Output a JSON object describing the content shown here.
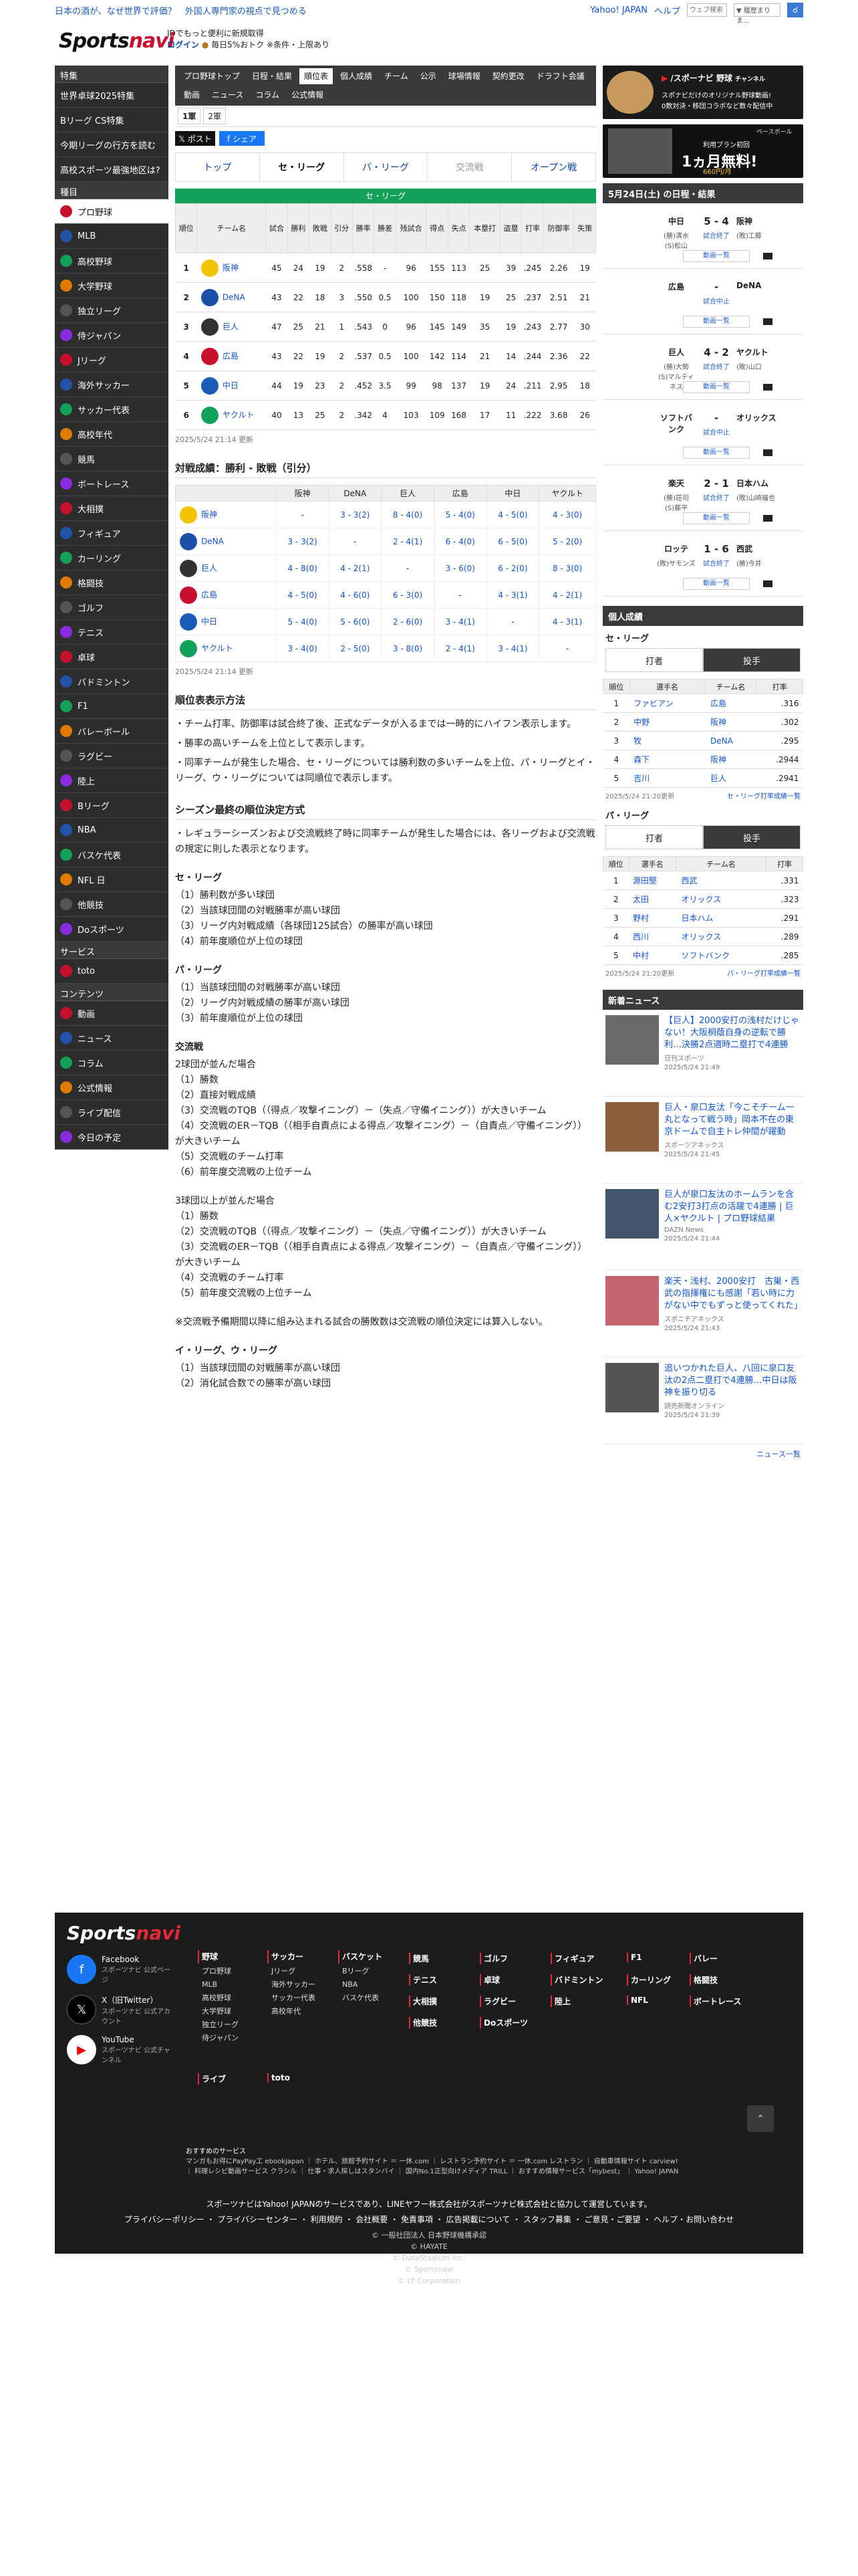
{
  "topbar": {
    "pr": "日本の酒が、なぜ世界で評価？　外国人専門家の視点で見つめる",
    "yahoo": "Yahoo! JAPAN",
    "help": "ヘルプ",
    "search_placeholder": "ウェブ検索",
    "search_scope": "▼ 履歴まり ま..."
  },
  "header": {
    "logo_a": "Sports",
    "logo_b": "navi",
    "id_line": "IDでもっと便利に新規取得",
    "login": "ログイン",
    "points": "毎日5%おトク ※条件・上限あり"
  },
  "sidebar": {
    "sec1": "特集",
    "sec1_items": [
      "世界卓球2025特集",
      "Bリーグ CS特集",
      "今期リーグの行方を読む",
      "高校スポーツ最強地区は?"
    ],
    "sec2": "種目",
    "sec2_items": [
      "プロ野球",
      "MLB",
      "高校野球",
      "大学野球",
      "独立リーグ",
      "侍ジャパン",
      "Jリーグ",
      "海外サッカー",
      "サッカー代表",
      "高校年代",
      "競馬",
      "ボートレース",
      "大相撲",
      "フィギュア",
      "カーリング",
      "格闘技",
      "ゴルフ",
      "テニス",
      "卓球",
      "バドミントン",
      "F1",
      "バレーボール",
      "ラグビー",
      "陸上",
      "Bリーグ",
      "NBA",
      "バスケ代表",
      "NFL 日",
      "他競技",
      "Doスポーツ"
    ],
    "sec3": "サービス",
    "sec3_items": [
      "toto"
    ],
    "sec4": "コンテンツ",
    "sec4_items": [
      "動画",
      "ニュース",
      "コラム",
      "公式情報",
      "ライブ配信",
      "今日の予定"
    ]
  },
  "tabs": [
    "プロ野球トップ",
    "日程・結果",
    "順位表",
    "個人成績",
    "チーム",
    "公示",
    "球場情報",
    "契約更改",
    "ドラフト会議",
    "動画",
    "ニュース",
    "コラム",
    "公式情報"
  ],
  "active_tab": "順位表",
  "subtabs": [
    "1軍",
    "2軍"
  ],
  "share": {
    "x": "𝕏 ポスト",
    "fb": "f シェア"
  },
  "league_tabs": [
    "トップ",
    "セ・リーグ",
    "パ・リーグ",
    "交流戦",
    "オープン戦"
  ],
  "standings": {
    "banner": "セ・リーグ",
    "headers": [
      "順位",
      "チーム名",
      "試合",
      "勝利",
      "敗戦",
      "引分",
      "勝率",
      "勝差",
      "残試合",
      "得点",
      "失点",
      "本塁打",
      "盗塁",
      "打率",
      "防御率",
      "失策"
    ],
    "rows": [
      [
        "1",
        "阪神",
        "45",
        "24",
        "19",
        "2",
        ".558",
        "-",
        "96",
        "155",
        "113",
        "25",
        "39",
        ".245",
        "2.26",
        "19"
      ],
      [
        "2",
        "DeNA",
        "43",
        "22",
        "18",
        "3",
        ".550",
        "0.5",
        "100",
        "150",
        "118",
        "19",
        "25",
        ".237",
        "2.51",
        "21"
      ],
      [
        "3",
        "巨人",
        "47",
        "25",
        "21",
        "1",
        ".543",
        "0",
        "96",
        "145",
        "149",
        "35",
        "19",
        ".243",
        "2.77",
        "30"
      ],
      [
        "4",
        "広島",
        "43",
        "22",
        "19",
        "2",
        ".537",
        "0.5",
        "100",
        "142",
        "114",
        "21",
        "14",
        ".244",
        "2.36",
        "22"
      ],
      [
        "5",
        "中日",
        "44",
        "19",
        "23",
        "2",
        ".452",
        "3.5",
        "99",
        "98",
        "137",
        "19",
        "24",
        ".211",
        "2.95",
        "18"
      ],
      [
        "6",
        "ヤクルト",
        "40",
        "13",
        "25",
        "2",
        ".342",
        "4",
        "103",
        "109",
        "168",
        "17",
        "11",
        ".222",
        "3.68",
        "26"
      ]
    ],
    "updated": "2025/5/24 21:14 更新"
  },
  "h2h": {
    "title": "対戦成績：勝利 - 敗戦（引分）",
    "headers": [
      "",
      "阪神",
      "DeNA",
      "巨人",
      "広島",
      "中日",
      "ヤクルト"
    ],
    "rows": [
      [
        "阪神",
        "-",
        "3 - 3(2)",
        "8 - 4(0)",
        "5 - 4(0)",
        "4 - 5(0)",
        "4 - 3(0)"
      ],
      [
        "DeNA",
        "3 - 3(2)",
        "-",
        "2 - 4(1)",
        "6 - 4(0)",
        "6 - 5(0)",
        "5 - 2(0)"
      ],
      [
        "巨人",
        "4 - 8(0)",
        "4 - 2(1)",
        "-",
        "3 - 6(0)",
        "6 - 2(0)",
        "8 - 3(0)"
      ],
      [
        "広島",
        "4 - 5(0)",
        "4 - 6(0)",
        "6 - 3(0)",
        "-",
        "4 - 3(1)",
        "4 - 2(1)"
      ],
      [
        "中日",
        "5 - 4(0)",
        "5 - 6(0)",
        "2 - 6(0)",
        "3 - 4(1)",
        "-",
        "4 - 3(1)"
      ],
      [
        "ヤクルト",
        "3 - 4(0)",
        "2 - 5(0)",
        "3 - 8(0)",
        "2 - 4(1)",
        "3 - 4(1)",
        "-"
      ]
    ],
    "updated": "2025/5/24 21:14 更新"
  },
  "rules": {
    "title1": "順位表表示方法",
    "p1": [
      "・チーム打率、防御率は試合終了後、正式なデータが入るまでは一時的にハイフン表示します。",
      "・勝率の高いチームを上位として表示します。",
      "・同率チームが発生した場合、セ・リーグについては勝利数の多いチームを上位、パ・リーグとイ・リーグ、ウ・リーグについては同順位で表示します。"
    ],
    "title2": "シーズン最終の順位決定方式",
    "p2": "・レギュラーシーズンおよび交流戦終了時に同率チームが発生した場合には、各リーグおよび交流戦の規定に則した表示となります。",
    "ce": "セ・リーグ",
    "ce_items": [
      "（1）勝利数が多い球団",
      "（2）当該球団間の対戦勝率が高い球団",
      "（3）リーグ内対戦成績（各球団125試合）の勝率が高い球団",
      "（4）前年度順位が上位の球団"
    ],
    "pa": "パ・リーグ",
    "pa_items": [
      "（1）当該球団間の対戦勝率が高い球団",
      "（2）リーグ内対戦成績の勝率が高い球団",
      "（3）前年度順位が上位の球団"
    ],
    "kr": "交流戦",
    "kr_a": "2球団が並んだ場合",
    "kr_a_items": [
      "（1）勝数",
      "（2）直接対戦成績",
      "（3）交流戦のTQB（（得点／攻撃イニング）－（失点／守備イニング））が大きいチーム",
      "（4）交流戦のER－TQB（（相手自責点による得点／攻撃イニング）－（自責点／守備イニング））が大きいチーム",
      "（5）交流戦のチーム打率",
      "（6）前年度交流戦の上位チーム"
    ],
    "kr_b": "3球団以上が並んだ場合",
    "kr_b_items": [
      "（1）勝数",
      "（2）交流戦のTQB（（得点／攻撃イニング）－（失点／守備イニング））が大きいチーム",
      "（3）交流戦のER－TQB（（相手自責点による得点／攻撃イニング）－（自責点／守備イニング））が大きいチーム",
      "（4）交流戦のチーム打率",
      "（5）前年度交流戦の上位チーム"
    ],
    "note": "※交流戦予備期間以降に組み込まれる試合の勝敗数は交流戦の順位決定には算入しない。",
    "iu": "イ・リーグ、ウ・リーグ",
    "iu_items": [
      "（1）当該球団間の対戦勝率が高い球団",
      "（2）消化試合数での勝率が高い球団"
    ]
  },
  "right": {
    "banner1": {
      "brand": "/スポーナビ 野球",
      "sub": "チャンネル",
      "l1": "スポナビだけのオリジナル野球動画!",
      "l2": "0数対決・移団コラボなど数々配信中"
    },
    "banner2": {
      "l1": "ベースボール",
      "l2": "利用プラン初回",
      "big": "1ヵ月無料!",
      "price": "660円/月"
    },
    "games_title": "5月24日(土) の日程・結果",
    "games": [
      {
        "t1": "中日",
        "p1": "(勝)清水\n(S)松山",
        "score": "5 - 4",
        "status": "試合終了",
        "t2": "阪神",
        "p2": "(敗)工藤"
      },
      {
        "t1": "広島",
        "p1": "",
        "score": "-",
        "status": "試合中止",
        "t2": "DeNA",
        "p2": ""
      },
      {
        "t1": "巨人",
        "p1": "(勝)大勢\n(S)マルティネス",
        "score": "4 - 2",
        "status": "試合終了",
        "t2": "ヤクルト",
        "p2": "(敗)山口"
      },
      {
        "t1": "ソフトバンク",
        "p1": "",
        "score": "-",
        "status": "試合中止",
        "t2": "オリックス",
        "p2": ""
      },
      {
        "t1": "楽天",
        "p1": "(勝)荘司\n(S)藤平",
        "score": "2 - 1",
        "status": "試合終了",
        "t2": "日本ハム",
        "p2": "(敗)山崎福也"
      },
      {
        "t1": "ロッテ",
        "p1": "(敗)サモンズ",
        "score": "1 - 6",
        "status": "試合終了",
        "t2": "西武",
        "p2": "(勝)今井"
      }
    ],
    "video_link": "動画一覧",
    "ind_title": "個人成績",
    "ce": "セ・リーグ",
    "pa": "パ・リーグ",
    "ind_tabs": [
      "打者",
      "投手"
    ],
    "ind_headers": [
      "順位",
      "選手名",
      "チーム名",
      "打率"
    ],
    "ce_rows": [
      [
        "1",
        "ファビアン",
        "広島",
        ".316"
      ],
      [
        "2",
        "中野",
        "阪神",
        ".302"
      ],
      [
        "3",
        "牧",
        "DeNA",
        ".295"
      ],
      [
        "4",
        "森下",
        "阪神",
        ".2944"
      ],
      [
        "5",
        "吉川",
        "巨人",
        ".2941"
      ]
    ],
    "ce_upd": "2025/5/24 21:20更新",
    "ce_link": "セ・リーグ打率成績一覧",
    "pa_rows": [
      [
        "1",
        "源田堅",
        "西武",
        ".331"
      ],
      [
        "2",
        "太田",
        "オリックス",
        ".323"
      ],
      [
        "3",
        "野村",
        "日本ハム",
        ".291"
      ],
      [
        "4",
        "西川",
        "オリックス",
        ".289"
      ],
      [
        "5",
        "中村",
        "ソフトバンク",
        ".285"
      ]
    ],
    "pa_upd": "2025/5/24 21:20更新",
    "pa_link": "パ・リーグ打率成績一覧",
    "news_title": "新着ニュース",
    "news": [
      {
        "t": "【巨人】2000安打の浅村だけじゃない！大阪桐蔭自身の逆転で勝利…決勝2点適時二塁打で4連勝",
        "s": "日刊スポーツ",
        "d": "2025/5/24 21:49"
      },
      {
        "t": "巨人・泉口友汰「今こそチーム一丸となって戦う時」岡本不在の東京ドームで自主トレ仲間が躍動",
        "s": "スポーツアネックス",
        "d": "2025/5/24 21:45"
      },
      {
        "t": "巨人が泉口友汰のホームランを含む2安打3打点の活躍で4連勝 | 巨人×ヤクルト | プロ野球結果",
        "s": "DAZN News",
        "d": "2025/5/24 21:44"
      },
      {
        "t": "楽天・浅村、2000安打　古巣・西武の指揮権にも感謝「若い時に力がない中でもずっと使ってくれた」",
        "s": "スポニチアネックス",
        "d": "2025/5/24 21:43"
      },
      {
        "t": "追いつかれた巨人、八回に泉口友汰の2点二塁打で4連勝…中日は阪神を振り切る",
        "s": "読売新聞オンライン",
        "d": "2025/5/24 21:39"
      }
    ],
    "news_link": "ニュース一覧"
  },
  "footer": {
    "logo_a": "Sports",
    "logo_b": "navi",
    "social": [
      {
        "n": "Facebook",
        "s": "スポーツナビ 公式ページ"
      },
      {
        "n": "X（旧Twitter）",
        "s": "スポーツナビ 公式アカウント"
      },
      {
        "n": "YouTube",
        "s": "スポーツナビ 公式チャンネル"
      }
    ],
    "cols": [
      {
        "h": "野球",
        "i": [
          "プロ野球",
          "MLB",
          "高校野球",
          "大学野球",
          "独立リーグ",
          "侍ジャパン"
        ]
      },
      {
        "h": "サッカー",
        "i": [
          "Jリーグ",
          "海外サッカー",
          "サッカー代表",
          "高校年代"
        ]
      },
      {
        "h": "バスケット",
        "i": [
          "Bリーグ",
          "NBA",
          "バスケ代表"
        ]
      }
    ],
    "grid": [
      "競馬",
      "ゴルフ",
      "フィギュア",
      "F1",
      "バレー",
      "テニス",
      "卓球",
      "バドミントン",
      "カーリング",
      "格闘技",
      "大相撲",
      "ラグビー",
      "陸上",
      "NFL",
      "ボートレース",
      "他競技",
      "Doスポーツ"
    ],
    "live": "ライブ",
    "toto": "toto",
    "rec_title": "おすすめのサービス",
    "rec_text": "マンガもお得にPayPay工 ebookjapan ｜ ホテル、旅館予約サイト ＝ 一休.com ｜ レストラン予約サイト ＝ 一休.com レストラン ｜ 自動車情報サイト carview! ｜ 料理レシピ動画サービス クラシル ｜ 仕事・求人探しはスタンバイ ｜ 国内No.1正型向けメディア TRILL ｜ おすすめ情報サービス「mybest」 ｜ Yahoo! JAPAN",
    "notice": "スポーツナビはYahoo! JAPANのサービスであり、LINEヤフー株式会社がスポーツナビ株式会社と協力して運営しています。",
    "links": "プライバシーポリシー ・ プライバシーセンター ・ 利用規約 ・ 会社概要 ・ 免責事項 ・ 広告掲載について ・ スタッフ募集 ・ ご意見・ご要望 ・ ヘルプ・お問い合わせ",
    "copy": [
      "© 一般社団法人 日本野球機構承認",
      "© HAYATE",
      "© DataStadium Inc.",
      "© Sportsnavi",
      "© LY Corporation"
    ]
  },
  "colors": {
    "accent": "#13a05a",
    "brand": "#c8102e",
    "link": "#1155cc",
    "dark": "#3a3a3a"
  }
}
